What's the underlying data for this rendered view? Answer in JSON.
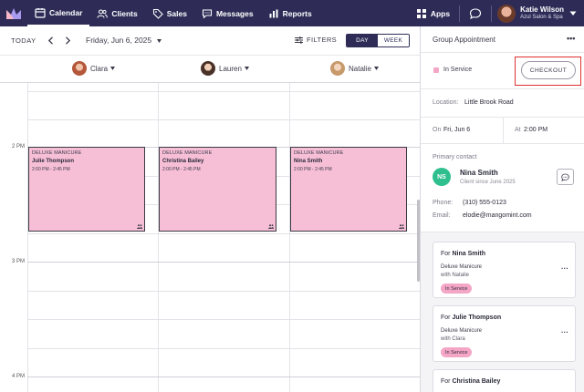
{
  "nav": {
    "items": [
      {
        "label": "Calendar",
        "icon": "calendar-icon",
        "active": true
      },
      {
        "label": "Clients",
        "icon": "clients-icon",
        "active": false
      },
      {
        "label": "Sales",
        "icon": "tag-icon",
        "active": false
      },
      {
        "label": "Messages",
        "icon": "chat-bubble-icon",
        "active": false
      },
      {
        "label": "Reports",
        "icon": "bar-chart-icon",
        "active": false
      }
    ],
    "apps_label": "Apps",
    "user_name": "Katie Wilson",
    "user_location": "Azul Salon & Spa"
  },
  "toolbar": {
    "today_label": "TODAY",
    "date_label": "Friday, Jun 6, 2025",
    "filters_label": "FILTERS",
    "view_day_label": "DAY",
    "view_week_label": "WEEK"
  },
  "staff": [
    {
      "name": "Clara",
      "avatar_color": "#c77a5a"
    },
    {
      "name": "Lauren",
      "avatar_color": "#a97458"
    },
    {
      "name": "Natalie",
      "avatar_color": "#d1a07c"
    }
  ],
  "time_labels": [
    "2 PM",
    "3 PM",
    "4 PM"
  ],
  "appointments": [
    {
      "service": "DELUXE MANICURE",
      "client": "Julie Thompson",
      "time": "2:00 PM - 2:45 PM"
    },
    {
      "service": "DELUXE MANICURE",
      "client": "Christina Bailey",
      "time": "2:00 PM - 2:45 PM"
    },
    {
      "service": "DELUXE MANICURE",
      "client": "Nina Smith",
      "time": "2:00 PM - 2:45 PM"
    }
  ],
  "panel": {
    "title": "Group Appointment",
    "status": "In Service",
    "checkout_label": "CHECKOUT",
    "location_label": "Location:",
    "location_value": "Little Brook Road",
    "on_label": "On",
    "on_value": "Fri, Jun 6",
    "at_label": "At",
    "at_value": "2:00 PM",
    "primary_contact_label": "Primary contact",
    "contact_initials": "NS",
    "contact_name": "Nina Smith",
    "contact_since": "Client since June 2025",
    "phone_label": "Phone:",
    "phone_value": "(310) 555-0123",
    "email_label": "Email:",
    "email_value": "elodie@mangomint.com",
    "cards": [
      {
        "for_label": "For",
        "name": "Nina Smith",
        "service": "Deluxe Manicure",
        "with": "with Natalie",
        "status": "In Service"
      },
      {
        "for_label": "For",
        "name": "Julie Thompson",
        "service": "Deluxe Manicure",
        "with": "with Clara",
        "status": "In Service"
      },
      {
        "for_label": "For",
        "name": "Christina Bailey"
      }
    ]
  },
  "colors": {
    "nav_bg": "#2e2c57",
    "appointment_bg": "#f7bfd6",
    "status_pink": "#f4a6c6",
    "contact_avatar": "#2fbf8f",
    "highlight_red": "#e03030"
  }
}
